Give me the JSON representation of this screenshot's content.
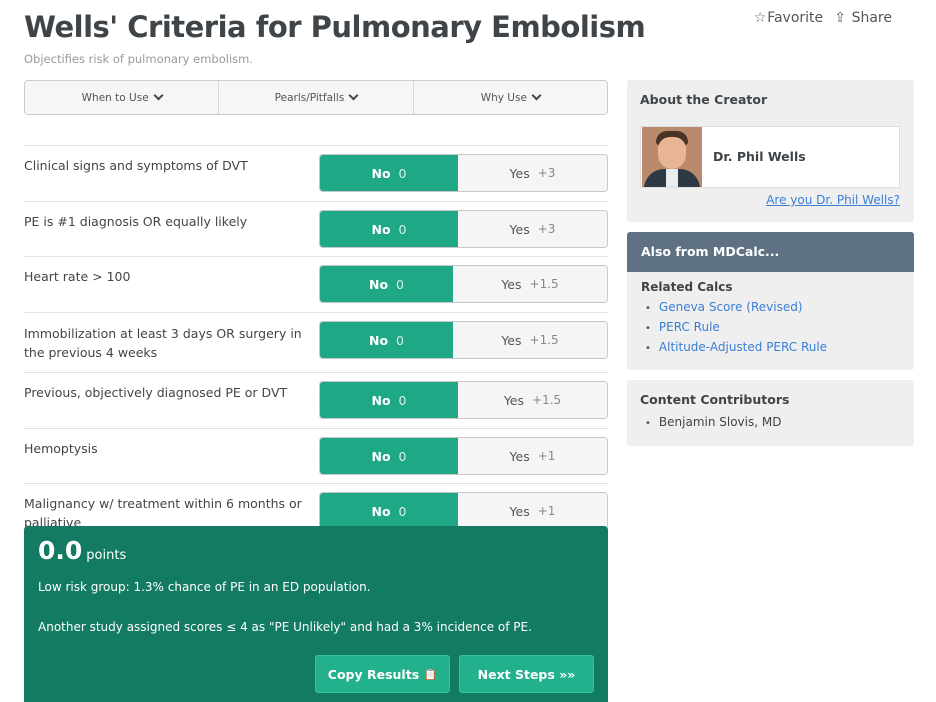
{
  "header": {
    "title": "Wells' Criteria for Pulmonary Embolism",
    "subtitle": "Objectifies risk of pulmonary embolism.",
    "favorite_label": "Favorite",
    "share_label": "Share",
    "favorite_icon": "☆",
    "share_icon": "⇪"
  },
  "info_tabs": [
    {
      "label": "When to Use"
    },
    {
      "label": "Pearls/Pitfalls"
    },
    {
      "label": "Why Use"
    }
  ],
  "criteria": [
    {
      "label": "Clinical signs and symptoms of DVT",
      "no_label": "No",
      "no_points": "0",
      "yes_label": "Yes",
      "yes_points": "+3"
    },
    {
      "label": "PE is #1 diagnosis OR equally likely",
      "no_label": "No",
      "no_points": "0",
      "yes_label": "Yes",
      "yes_points": "+3"
    },
    {
      "label": "Heart rate > 100",
      "no_label": "No",
      "no_points": "0",
      "yes_label": "Yes",
      "yes_points": "+1.5"
    },
    {
      "label": "Immobilization at least 3 days OR surgery in the previous 4 weeks",
      "no_label": "No",
      "no_points": "0",
      "yes_label": "Yes",
      "yes_points": "+1.5"
    },
    {
      "label": "Previous, objectively diagnosed PE or DVT",
      "no_label": "No",
      "no_points": "0",
      "yes_label": "Yes",
      "yes_points": "+1.5"
    },
    {
      "label": "Hemoptysis",
      "no_label": "No",
      "no_points": "0",
      "yes_label": "Yes",
      "yes_points": "+1"
    },
    {
      "label": "Malignancy w/ treatment within 6 months or palliative",
      "no_label": "No",
      "no_points": "0",
      "yes_label": "Yes",
      "yes_points": "+1"
    }
  ],
  "result": {
    "score": "0.0",
    "unit": "points",
    "line1": "Low risk group: 1.3% chance of PE in an ED population.",
    "line2": "Another study assigned scores ≤ 4 as \"PE Unlikely\" and had a 3% incidence of PE.",
    "copy_label": "Copy Results",
    "copy_icon": "📋",
    "next_label": "Next Steps",
    "next_icon": "»»"
  },
  "creator": {
    "heading": "About the Creator",
    "name": "Dr. Phil Wells",
    "link": "Are you Dr. Phil Wells?"
  },
  "also": {
    "heading": "Also from MDCalc...",
    "related_title": "Related Calcs",
    "related": [
      "Geneva Score (Revised)",
      "PERC Rule",
      "Altitude-Adjusted PERC Rule"
    ]
  },
  "contributors": {
    "heading": "Content Contributors",
    "names": [
      "Benjamin Slovis, MD"
    ]
  },
  "colors": {
    "selected_green": "#1fa885",
    "result_green": "#147b63",
    "link_blue": "#3a7fd4",
    "also_header": "#5e7284"
  }
}
